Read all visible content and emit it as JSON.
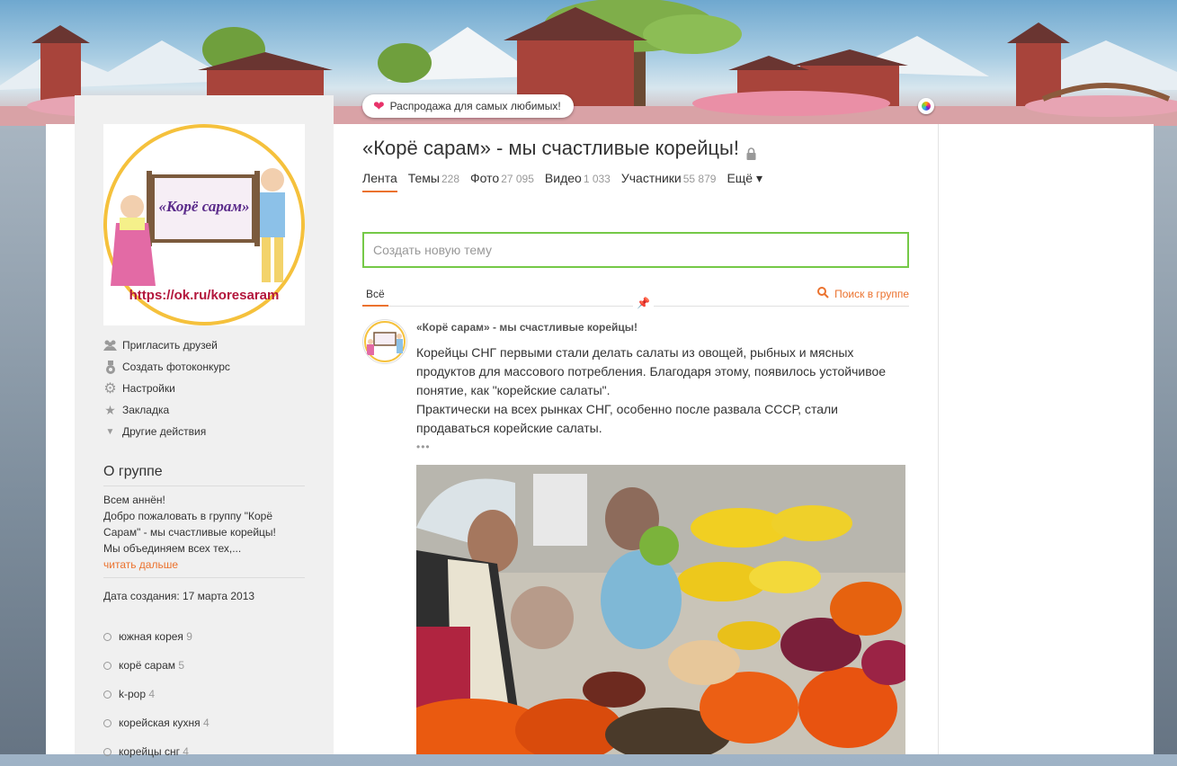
{
  "banner": {
    "promo_label": "Распродажа для самых любимых!"
  },
  "group": {
    "title": "«Корё сарам» - мы счастливые корейцы!",
    "avatar_caption": "«Корё сарам»",
    "avatar_url_text": "https://ok.ru/koresaram"
  },
  "tabs": [
    {
      "label": "Лента",
      "count": ""
    },
    {
      "label": "Темы",
      "count": "228"
    },
    {
      "label": "Фото",
      "count": "27 095"
    },
    {
      "label": "Видео",
      "count": "1 033"
    },
    {
      "label": "Участники",
      "count": "55 879"
    },
    {
      "label": "Ещё ▾",
      "count": ""
    }
  ],
  "menu": [
    {
      "label": "Пригласить друзей",
      "icon": "friends-icon"
    },
    {
      "label": "Создать фотоконкурс",
      "icon": "medal-icon"
    },
    {
      "label": "Настройки",
      "icon": "gear-icon"
    },
    {
      "label": "Закладка",
      "icon": "star-icon"
    },
    {
      "label": "Другие действия",
      "icon": "triangle-down-icon"
    }
  ],
  "about": {
    "title": "О группе",
    "line1": "Всем аннён!",
    "line2": "Добро пожаловать в группу \"Корё Сарам\" - мы счастливые корейцы!",
    "line3": "Мы объединяем всех тех,...",
    "read_more": "читать дальше",
    "created": "Дата создания: 17 марта 2013"
  },
  "tags": [
    {
      "name": "южная корея",
      "count": "9"
    },
    {
      "name": "корё сарам",
      "count": "5"
    },
    {
      "name": "k-pop",
      "count": "4"
    },
    {
      "name": "корейская кухня",
      "count": "4"
    },
    {
      "name": "корейцы снг",
      "count": "4"
    }
  ],
  "feed": {
    "new_topic_placeholder": "Создать новую тему",
    "filter_all": "Всё",
    "search_label": "Поиск в группе"
  },
  "post": {
    "author": "«Корё сарам» - мы счастливые корейцы!",
    "para1": "Корейцы СНГ первыми стали делать салаты из овощей, рыбных и мясных продуктов для массового потребления. Благодаря этому, появилось устойчивое понятие, как \"корейские салаты\".",
    "para2": "Практически на всех рынках СНГ, особенно после развала СССР, стали продаваться корейские салаты.",
    "more": "•••"
  },
  "colors": {
    "accent": "#eb722e",
    "green_border": "#75c947"
  }
}
